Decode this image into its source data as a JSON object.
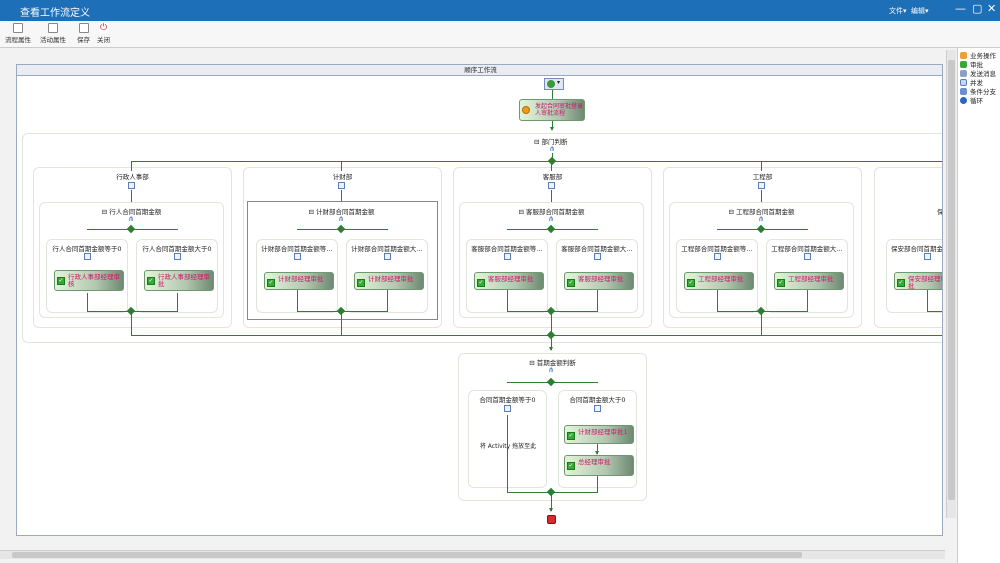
{
  "window": {
    "title": "查看工作流定义",
    "menu_file": "文件▾",
    "menu_edit": "编辑▾",
    "min": "—",
    "restore": "▢",
    "close": "✕"
  },
  "toolbar": {
    "process_props": "流程属性",
    "activity_props": "活动属性",
    "save": "保存",
    "close": "关闭"
  },
  "workflow": {
    "header": "顺序工作流",
    "start_activity": "发起合同审批登录人审批流程",
    "dept_branch": "部门判断",
    "departments": [
      {
        "name": "行政人事部",
        "cond": "行人合同首期金额",
        "left": "行人合同首期金额等于0",
        "right": "行人合同首期金额大于0",
        "left_act": "行政人事部经理审核",
        "right_act": "行政人事部经理审批"
      },
      {
        "name": "计财部",
        "cond": "计财部合同首期金额",
        "left": "计财部合同首期金额等…",
        "right": "计财部合同首期金额大…",
        "left_act": "计财部经理审批",
        "right_act": "计财部经理审批"
      },
      {
        "name": "客服部",
        "cond": "客服部合同首期金额",
        "left": "客服部合同首期金额等…",
        "right": "客服部合同首期金额大…",
        "left_act": "客服部经理审批",
        "right_act": "客服部经理审批"
      },
      {
        "name": "工程部",
        "cond": "工程部合同首期金额",
        "left": "工程部合同首期金额等…",
        "right": "工程部合同首期金额大…",
        "left_act": "工程部经理审批",
        "right_act": "工程部经理审批"
      },
      {
        "name": "",
        "cond": "保",
        "left": "保安部合同首期金额",
        "left_act": "保安部经理审批"
      }
    ],
    "final_branch": "首期金额判断",
    "final_left": "合同首期金额等于0",
    "final_right": "合同首期金额大于0",
    "drop_hint": "将 Activity 拖放至此",
    "final_act1": "计财部经理审批1",
    "final_act2": "总经理审批"
  },
  "toolbox": [
    "业务操作",
    "审批",
    "发送消息",
    "并发",
    "条件分支",
    "循环"
  ]
}
